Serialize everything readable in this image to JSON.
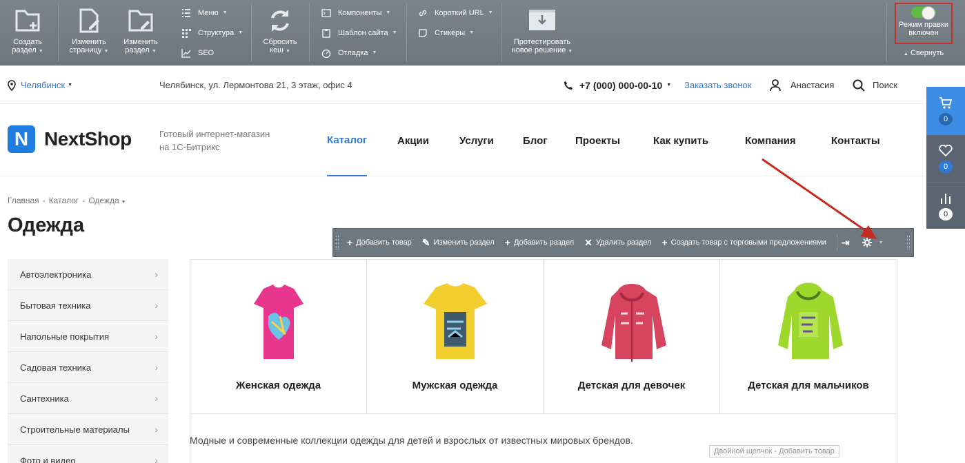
{
  "admin": {
    "create_section": {
      "label1": "Создать",
      "label2": "раздел"
    },
    "edit_page": {
      "label1": "Изменить",
      "label2": "страницу"
    },
    "edit_section": {
      "label1": "Изменить",
      "label2": "раздел"
    },
    "menu": "Меню",
    "structure": "Структура",
    "seo": "SEO",
    "reset_cache": {
      "label1": "Сбросить",
      "label2": "кеш"
    },
    "components": "Компоненты",
    "template": "Шаблон сайта",
    "debug": "Отладка",
    "short_url": "Короткий URL",
    "stickers": "Стикеры",
    "test_solution": {
      "label1": "Протестировать",
      "label2": "новое решение"
    },
    "edit_mode": {
      "label1": "Режим правки",
      "label2": "включен",
      "on": true
    },
    "collapse": "Свернуть"
  },
  "topbar": {
    "city": "Челябинск",
    "address": "Челябинск, ул. Лермонтова 21, 3 этаж, офис 4",
    "phone": "+7 (000) 000-00-10",
    "callback": "Заказать звонок",
    "user": "Анастасия",
    "search": "Поиск"
  },
  "header": {
    "logo_letter": "N",
    "logo_text": "NextShop",
    "tagline1": "Готовый интернет-магазин",
    "tagline2": "на 1С-Битрикс",
    "nav": [
      "Каталог",
      "Акции",
      "Услуги",
      "Блог",
      "Проекты",
      "Как купить",
      "Компания",
      "Контакты"
    ]
  },
  "sidepanel": {
    "cart_count": "0",
    "fav_count": "0",
    "compare_count": "0"
  },
  "breadcrumbs": [
    "Главная",
    "Каталог",
    "Одежда"
  ],
  "page_title": "Одежда",
  "left_menu": [
    "Автоэлектроника",
    "Бытовая техника",
    "Напольные покрытия",
    "Садовая техника",
    "Сантехника",
    "Строительные материалы",
    "Фото и видео"
  ],
  "sections": [
    "Женская одежда",
    "Мужская одежда",
    "Детская для девочек",
    "Детская для мальчиков"
  ],
  "description": "Модные и современные коллекции одежды для детей и взрослых от известных мировых брендов.",
  "hint": "Двойной щелчок - Добавить товар",
  "edit_toolbar": {
    "add_product": "Добавить товар",
    "edit_section": "Изменить раздел",
    "add_section": "Добавить раздел",
    "delete_section": "Удалить раздел",
    "create_with_offers": "Создать товар с торговыми предложениями"
  },
  "colors": {
    "accent": "#2f7ad6",
    "admin_bg": "#737c83",
    "highlight": "#c9302c",
    "toggle_on": "#5ebd3e"
  }
}
